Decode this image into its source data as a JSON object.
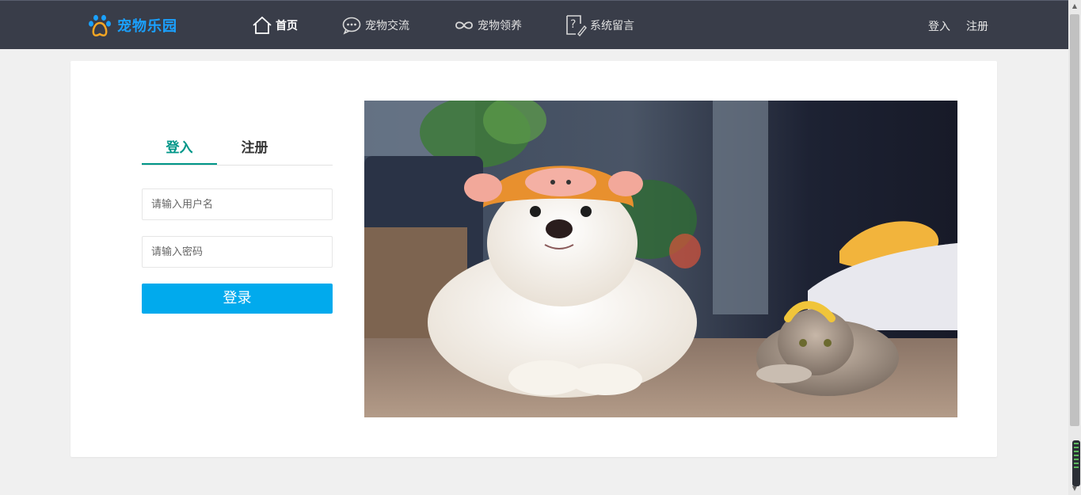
{
  "brand": {
    "name": "宠物乐园",
    "logo_icon": "paw-icon",
    "color": "#1aa1ff"
  },
  "nav": [
    {
      "label": "首页",
      "icon": "home-icon",
      "active": true
    },
    {
      "label": "宠物交流",
      "icon": "chat-icon",
      "active": false
    },
    {
      "label": "宠物领养",
      "icon": "infinity-icon",
      "active": false
    },
    {
      "label": "系统留言",
      "icon": "question-note-icon",
      "active": false
    }
  ],
  "auth": {
    "login_label": "登入",
    "register_label": "注册"
  },
  "form": {
    "tabs": [
      {
        "label": "登入",
        "active": true
      },
      {
        "label": "注册",
        "active": false
      }
    ],
    "username_placeholder": "请输入用户名",
    "password_placeholder": "请输入密码",
    "submit_label": "登录"
  },
  "colors": {
    "topbar": "#393d49",
    "accent_tab": "#009688",
    "button": "#01aaed"
  }
}
